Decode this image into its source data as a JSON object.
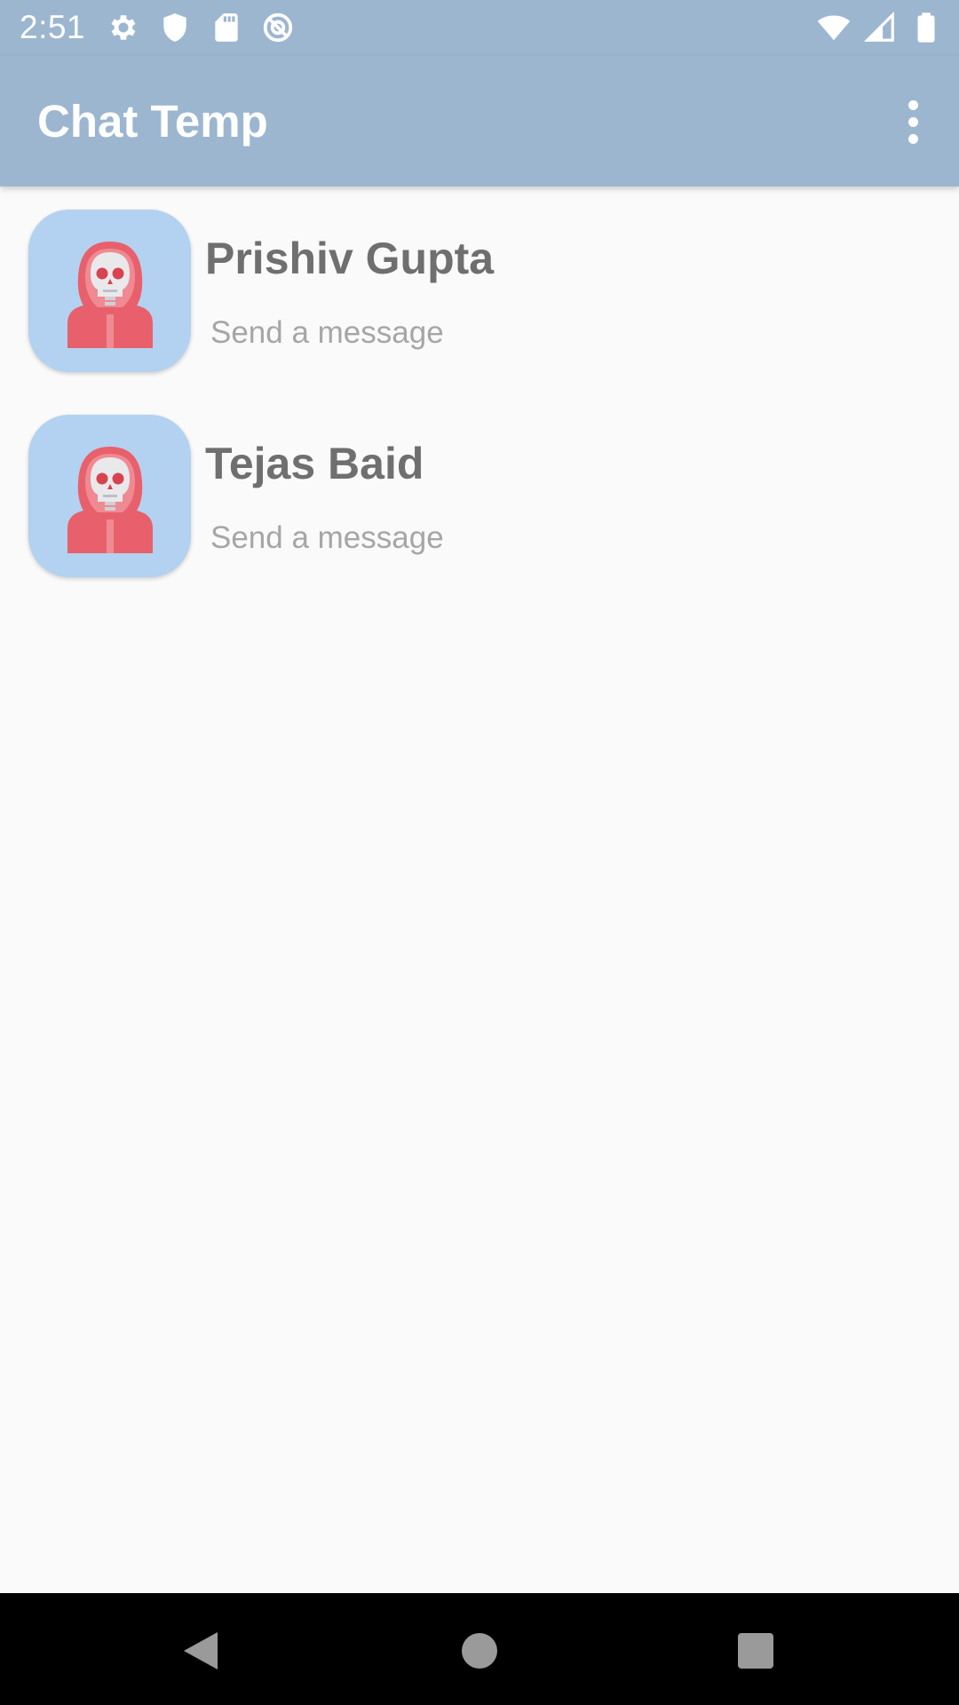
{
  "status_bar": {
    "time": "2:51",
    "left_icons": [
      "settings-icon",
      "shield-icon",
      "sd-card-icon",
      "no-sync-icon"
    ],
    "right_icons": [
      "wifi-icon",
      "cell-signal-icon",
      "battery-icon"
    ]
  },
  "app_bar": {
    "title": "Chat Temp",
    "overflow_icon": "more-vert-icon"
  },
  "chats": [
    {
      "name": "Prishiv Gupta",
      "preview": "Send a message",
      "avatar_icon": "hooded-skull-avatar-icon"
    },
    {
      "name": "Tejas Baid",
      "preview": "Send a message",
      "avatar_icon": "hooded-skull-avatar-icon"
    }
  ],
  "nav_bar": {
    "back_icon": "back-triangle-icon",
    "home_icon": "home-circle-icon",
    "recents_icon": "recents-square-icon"
  },
  "colors": {
    "app_bar": "#9cb6d0",
    "avatar_bg": "#b3d1f0",
    "name_text": "#6f6f6f",
    "preview_text": "#a6a6a6",
    "background": "#fafafa"
  }
}
